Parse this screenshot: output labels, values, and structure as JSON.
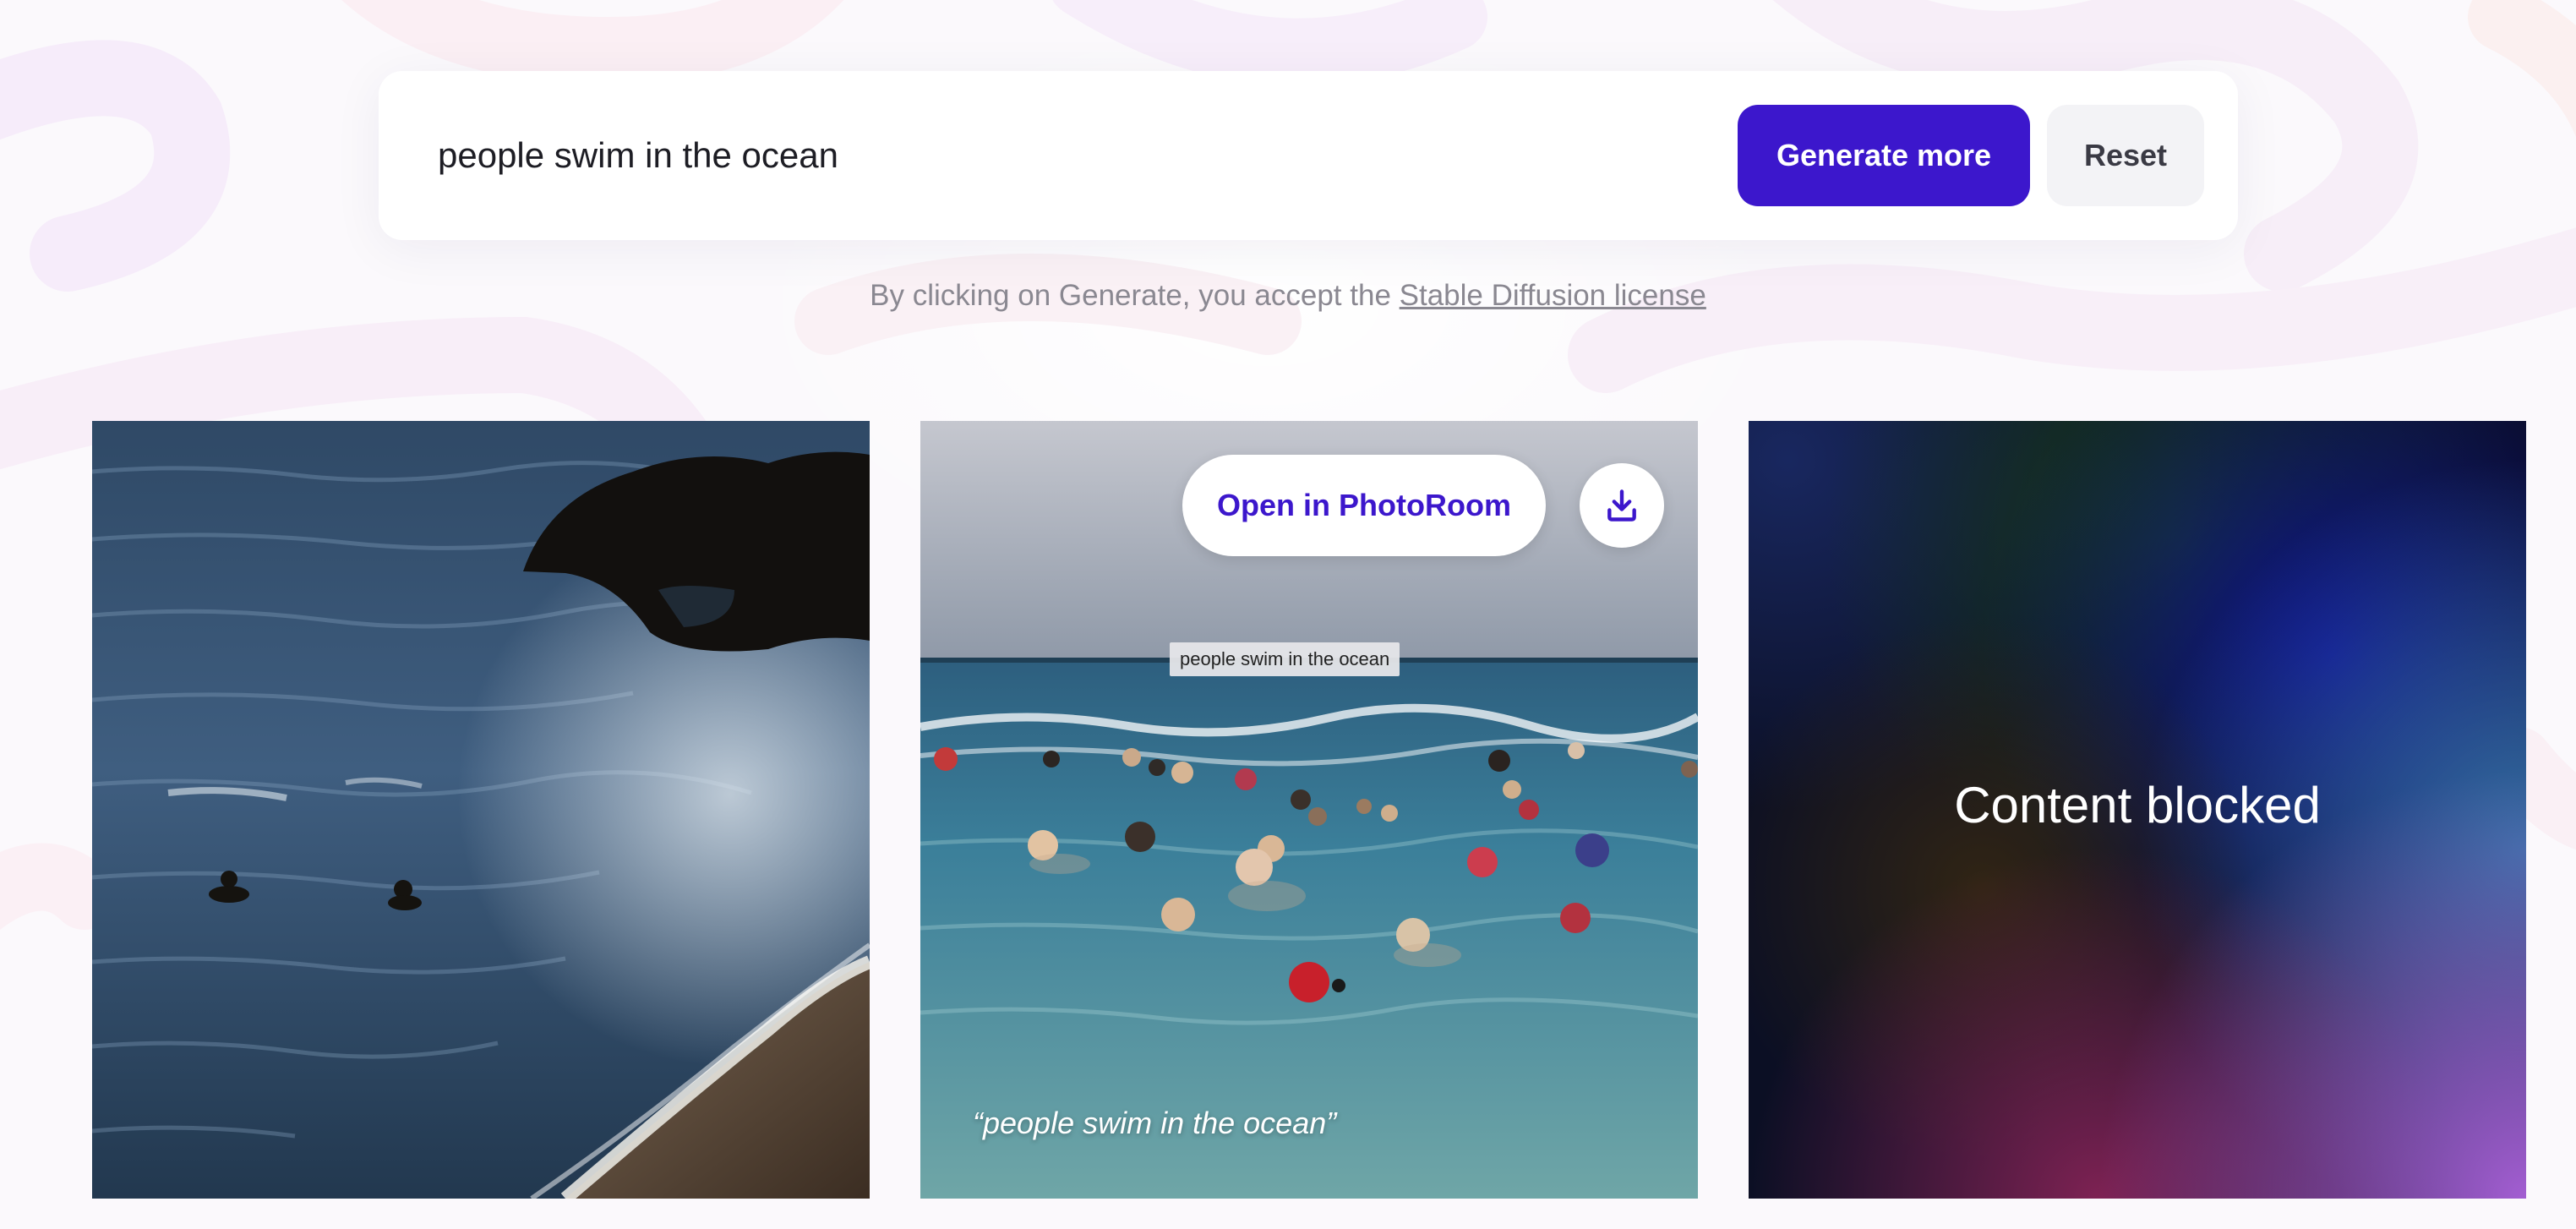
{
  "prompt": {
    "value": "people swim in the ocean",
    "placeholder": ""
  },
  "actions": {
    "generate_label": "Generate more",
    "reset_label": "Reset"
  },
  "license": {
    "prefix": "By clicking on Generate, you accept the ",
    "link_text": "Stable Diffusion license"
  },
  "results": {
    "tile2": {
      "open_label": "Open in PhotoRoom",
      "download_icon": "download-icon",
      "tooltip": "people swim in the ocean",
      "caption": "“people swim in the ocean”"
    },
    "tile3": {
      "blocked_label": "Content blocked"
    }
  },
  "colors": {
    "accent": "#3c17cc",
    "reset_bg": "#f3f3f6",
    "license_text": "#8a8891"
  }
}
